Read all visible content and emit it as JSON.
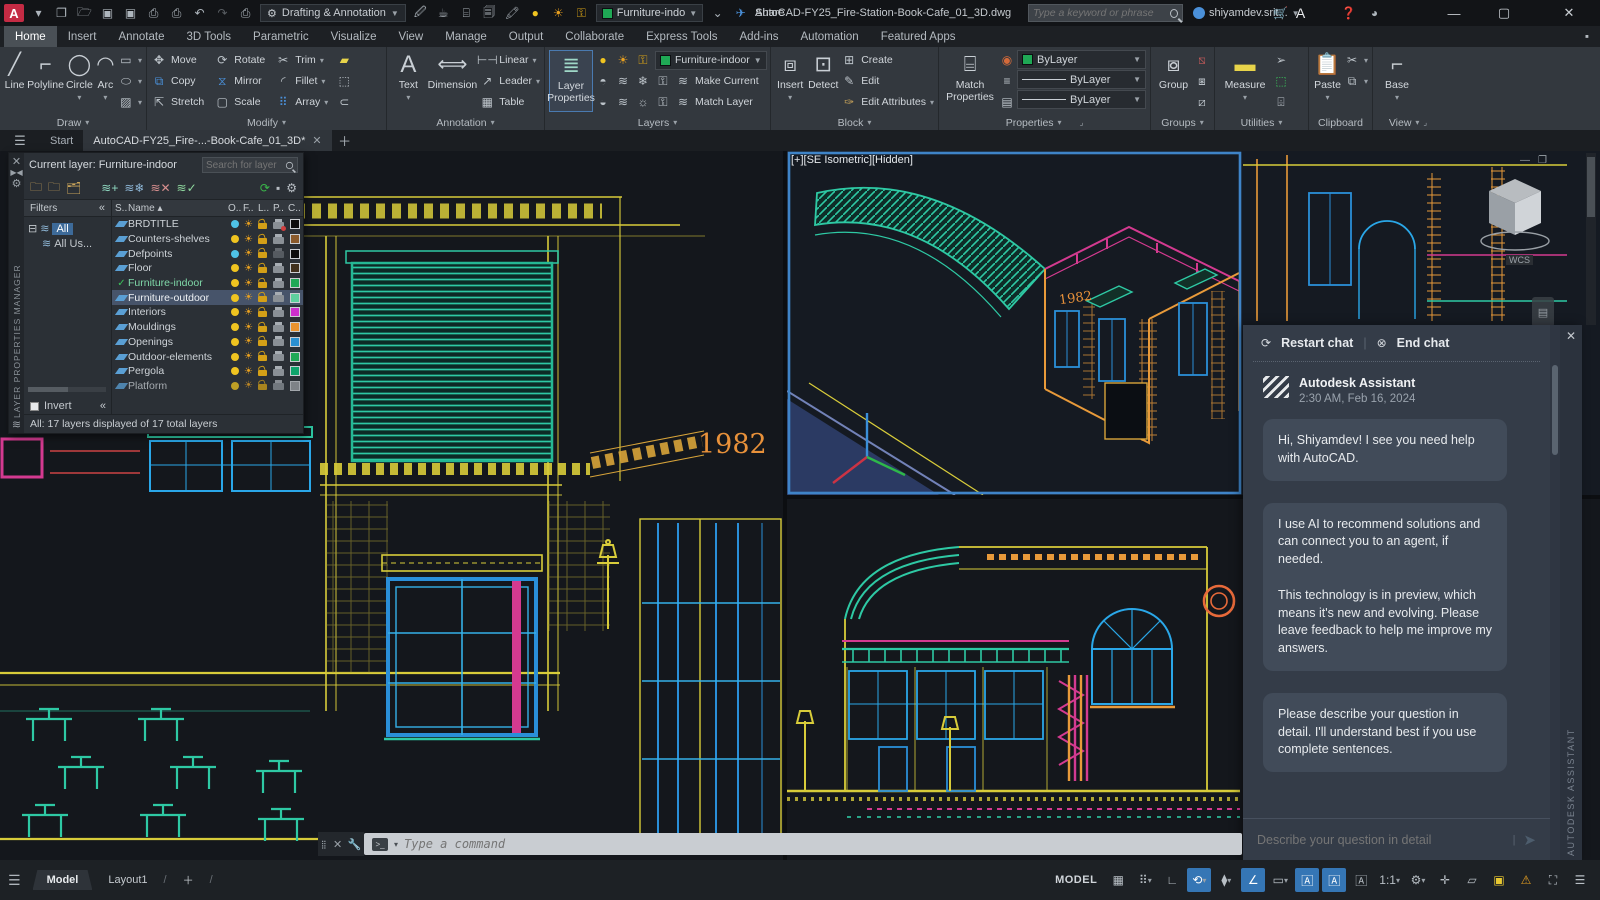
{
  "titlebar": {
    "app_menu": "A",
    "workspace": "Drafting & Annotation",
    "quick_layer": "Furniture-indo",
    "share": "Share",
    "doc_title": "AutoCAD-FY25_Fire-Station-Book-Cafe_01_3D.dwg",
    "search_placeholder": "Type a keyword or phrase",
    "user": "shiyamdev.srit..."
  },
  "ribbon": {
    "tabs": [
      "Home",
      "Insert",
      "Annotate",
      "3D Tools",
      "Parametric",
      "Visualize",
      "View",
      "Manage",
      "Output",
      "Collaborate",
      "Express Tools",
      "Add-ins",
      "Automation",
      "Featured Apps"
    ],
    "active_tab": "Home",
    "draw": {
      "title": "Draw",
      "line": "Line",
      "polyline": "Polyline",
      "circle": "Circle",
      "arc": "Arc"
    },
    "modify": {
      "title": "Modify",
      "move": "Move",
      "copy": "Copy",
      "stretch": "Stretch",
      "rotate": "Rotate",
      "mirror": "Mirror",
      "scale": "Scale",
      "trim": "Trim",
      "fillet": "Fillet",
      "array": "Array"
    },
    "annotation": {
      "title": "Annotation",
      "text": "Text",
      "dimension": "Dimension",
      "linear": "Linear",
      "leader": "Leader",
      "table": "Table"
    },
    "layers": {
      "title": "Layers",
      "layer_properties": "Layer Properties",
      "dropdown_value": "Furniture-indoor",
      "make_current": "Make Current",
      "match_layer": "Match Layer"
    },
    "block": {
      "title": "Block",
      "insert": "Insert",
      "detect": "Detect",
      "create": "Create",
      "edit": "Edit",
      "edit_attributes": "Edit Attributes"
    },
    "properties": {
      "title": "Properties",
      "match_properties": "Match Properties",
      "color": "ByLayer",
      "lineweight": "ByLayer",
      "linetype": "ByLayer"
    },
    "groups": {
      "title": "Groups",
      "group": "Group"
    },
    "utilities": {
      "title": "Utilities",
      "measure": "Measure"
    },
    "clipboard": {
      "title": "Clipboard",
      "paste": "Paste"
    },
    "view": {
      "title": "View",
      "base": "Base"
    }
  },
  "file_tabs": {
    "start": "Start",
    "doc": "AutoCAD-FY25_Fire-...-Book-Cafe_01_3D*"
  },
  "layer_manager": {
    "vertical_title": "LAYER PROPERTIES MANAGER",
    "current_layer_label": "Current layer: Furniture-indoor",
    "search_placeholder": "Search for layer",
    "filters_label": "Filters",
    "tree_all": "All",
    "tree_all_used": "All Us...",
    "columns": {
      "status": "S..",
      "name": "Name",
      "on": "O..",
      "freeze": "F..",
      "lock": "L..",
      "plot": "P..",
      "color": "C.."
    },
    "layers": [
      {
        "name": "BRDTITLE",
        "color": "#0c0c0c",
        "bulb": "#4fc3e8"
      },
      {
        "name": "Counters-shelves",
        "color": "#8a5a2b",
        "bulb": "#f0c420"
      },
      {
        "name": "Defpoints",
        "color": "#0c0c0c",
        "bulb": "#4fc3e8"
      },
      {
        "name": "Floor",
        "color": "#40301c",
        "bulb": "#f0c420"
      },
      {
        "name": "Furniture-indoor",
        "color": "#1fa855",
        "bulb": "#f0c420"
      },
      {
        "name": "Furniture-outdoor",
        "color": "#5ecf9e",
        "bulb": "#f0c420"
      },
      {
        "name": "Interiors",
        "color": "#cc2fcc",
        "bulb": "#f0c420"
      },
      {
        "name": "Mouldings",
        "color": "#e8922e",
        "bulb": "#f0c420"
      },
      {
        "name": "Openings",
        "color": "#2a8fd0",
        "bulb": "#f0c420"
      },
      {
        "name": "Outdoor-elements",
        "color": "#1fa855",
        "bulb": "#f0c420"
      },
      {
        "name": "Pergola",
        "color": "#0fa36b",
        "bulb": "#f0c420"
      },
      {
        "name": "Platform",
        "color": "#9a9ea2",
        "bulb": "#f0c420"
      }
    ],
    "invert_label": "Invert",
    "status": "All: 17 layers displayed of 17 total layers"
  },
  "viewports": {
    "active_label": "[+][SE Isometric][Hidden]",
    "wcs": "WCS",
    "sign_text": "1982"
  },
  "chat": {
    "restart": "Restart chat",
    "end": "End chat",
    "assistant_name": "Autodesk Assistant",
    "timestamp": "2:30 AM, Feb 16, 2024",
    "msg1": "Hi, Shiyamdev! I see you need help with AutoCAD.",
    "msg2a": "I use AI to recommend solutions and can connect you to an agent, if needed.",
    "msg2b": "This technology is in preview, which means it's new and evolving. Please leave feedback to help me improve my answers.",
    "msg3": "Please describe your question in detail. I'll understand best if you use complete sentences.",
    "input_placeholder": "Describe your question in detail",
    "vertical_title": "AUTODESK ASSISTANT"
  },
  "command_line": {
    "placeholder": "Type a command"
  },
  "status_bar": {
    "model_tab": "Model",
    "layout_tab": "Layout1",
    "model_badge": "MODEL",
    "scale": "1:1"
  },
  "colors": {
    "cad_yellow": "#d8cc3a",
    "cad_cyan": "#2aa7e8",
    "cad_blue": "#2a8fd8",
    "cad_teal": "#2ec9a4",
    "cad_green": "#1fa855",
    "cad_magenta": "#d43a90",
    "cad_orange": "#e89a3a",
    "road_blue": "#2b3a63",
    "active_viewport_border": "#3f84c8",
    "status_active": "#3576b5"
  }
}
